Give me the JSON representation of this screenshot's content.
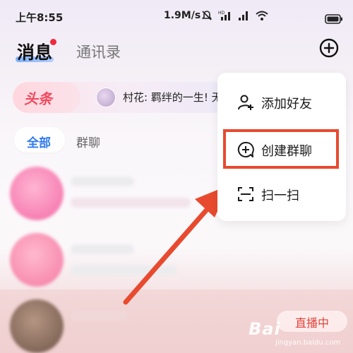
{
  "status_bar": {
    "time": "上午8:55",
    "network_speed": "1.9M/s",
    "icons": [
      "mute-icon",
      "hd-signal-icon",
      "signal-icon",
      "wifi-icon",
      "battery-icon"
    ]
  },
  "header": {
    "tabs": [
      {
        "label": "消息",
        "active": true,
        "has_dot": true
      },
      {
        "label": "通讯录",
        "active": false
      }
    ],
    "plus_icon": "add-circle-icon"
  },
  "headline": {
    "tag": "头条",
    "text": "村花: 羁绊的一生! 无"
  },
  "filters": [
    {
      "label": "全部",
      "active": true
    },
    {
      "label": "群聊",
      "active": false
    }
  ],
  "popup_menu": {
    "items": [
      {
        "label": "添加好友",
        "icon": "add-friend-icon"
      },
      {
        "label": "创建群聊",
        "icon": "create-group-icon",
        "highlighted": true
      },
      {
        "label": "扫一扫",
        "icon": "scan-icon"
      }
    ]
  },
  "live_badge": "直播中",
  "watermark": {
    "brand": "Bai",
    "sub": "jingyan.baidu.com"
  },
  "colors": {
    "accent_blue": "#2f7bf0",
    "headline_red": "#f0495f",
    "highlight": "#e84a2f",
    "unread_dot": "#ee2a3c"
  }
}
